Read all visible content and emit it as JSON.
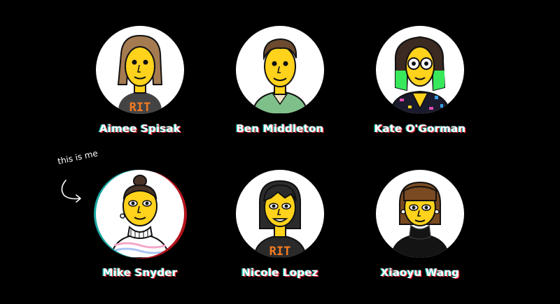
{
  "annotation": {
    "text": "this is me",
    "icon": "curved-arrow-icon"
  },
  "members": [
    {
      "name": "Aimee Spisak",
      "icon": "avatar-aimee-icon",
      "selected": false
    },
    {
      "name": "Ben Middleton",
      "icon": "avatar-ben-icon",
      "selected": false
    },
    {
      "name": "Kate O'Gorman",
      "icon": "avatar-kate-icon",
      "selected": false
    },
    {
      "name": "Mike Snyder",
      "icon": "avatar-mike-icon",
      "selected": true
    },
    {
      "name": "Nicole Lopez",
      "icon": "avatar-nicole-icon",
      "selected": false
    },
    {
      "name": "Xiaoyu Wang",
      "icon": "avatar-xiaoyu-icon",
      "selected": false
    }
  ],
  "colors": {
    "background": "#000000",
    "skin": "#ffd21c",
    "glitch_cyan": "#19c7c0",
    "glitch_red": "#e0242c",
    "rit_orange": "#f47b20"
  }
}
